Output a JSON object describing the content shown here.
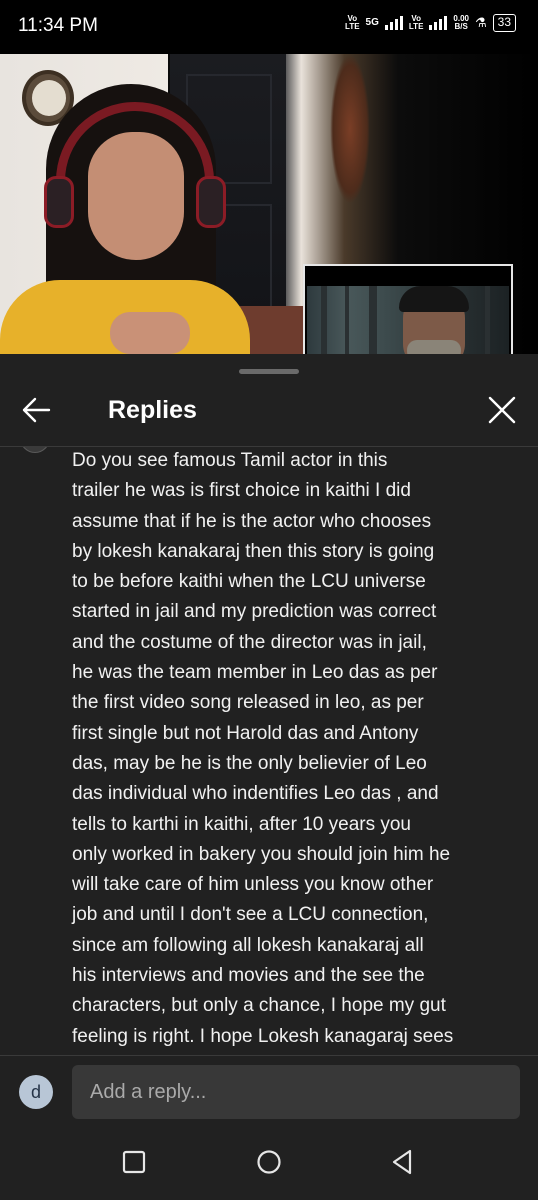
{
  "status_bar": {
    "time": "11:34 PM",
    "sim1_tag": "Vo\nLTE",
    "network_tag": "5G",
    "sim2_tag": "Vo\nLTE",
    "data_speed": "0.00\nB/S",
    "battery": "33"
  },
  "video": {
    "pip_accent": "#e6e6e6"
  },
  "panel": {
    "title": "Replies",
    "back_icon": "arrow-left-icon",
    "close_icon": "close-icon"
  },
  "reply": {
    "text": "Do you see famous Tamil actor in this\ntrailer he was is first choice  in kaithi I did\nassume that if he is the actor who chooses\nby lokesh kanakaraj then this story is going\nto be before kaithi when the LCU universe\nstarted in jail and my prediction was correct\nand the costume of the director was in jail,\nhe was the team member in Leo das as per\nthe first video song released in leo, as per\nfirst single but not Harold das and Antony\ndas, may be he is the only believier of Leo\ndas individual  who indentifies Leo das , and\ntells to karthi in kaithi, after 10 years you\nonly worked in bakery you should join him he\nwill take care of him unless you know other\njob  and until I don't see a LCU connection,\nsince am following all lokesh kanakaraj all\nhis interviews and movies and the see the\ncharacters, but only a chance, I hope my gut\nfeeling is right. I hope Lokesh kanagaraj sees"
  },
  "composer": {
    "avatar_letter": "d",
    "placeholder": "Add a reply..."
  },
  "nav": {
    "recents_icon": "square-icon",
    "home_icon": "circle-icon",
    "back_icon": "triangle-back-icon"
  },
  "colors": {
    "panel_bg": "#212121",
    "input_bg": "#383838",
    "avatar_bg": "#b8c6d6"
  }
}
